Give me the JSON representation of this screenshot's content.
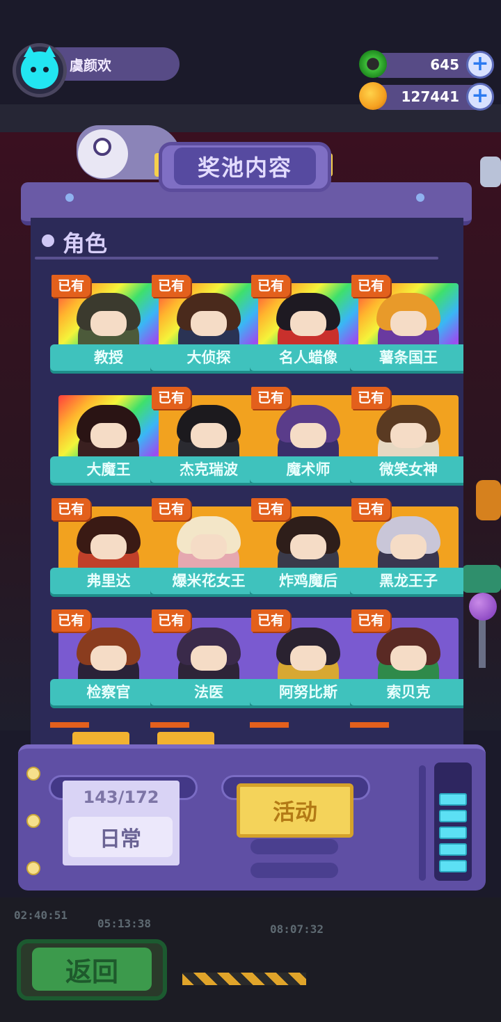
{
  "player": {
    "name": "虞颜欢"
  },
  "currencies": [
    {
      "icon": "green-ring-icon",
      "value": "645",
      "color": "#3fbf3a"
    },
    {
      "icon": "orange-planet-icon",
      "value": "127441",
      "color": "#f5a020"
    }
  ],
  "panel": {
    "title": "奖池内容",
    "section": "角色"
  },
  "owned_label": "已有",
  "characters": [
    {
      "name": "教授",
      "owned": true,
      "rarity": "rainbow",
      "hair": "#3b3a2e",
      "body": "#4c5a3a"
    },
    {
      "name": "大侦探",
      "owned": true,
      "rarity": "rainbow",
      "hair": "#4a2a1c",
      "body": "#2a3354"
    },
    {
      "name": "名人蜡像",
      "owned": true,
      "rarity": "rainbow",
      "hair": "#1e1a22",
      "body": "#c9302c"
    },
    {
      "name": "薯条国王",
      "owned": true,
      "rarity": "rainbow",
      "hair": "#e89a2a",
      "body": "#6a3aa0"
    },
    {
      "name": "大魔王",
      "owned": false,
      "rarity": "rainbow",
      "hair": "#2a1414",
      "body": "#3a2020"
    },
    {
      "name": "杰克瑞波",
      "owned": true,
      "rarity": "gold",
      "hair": "#1c1a1e",
      "body": "#2a2a30"
    },
    {
      "name": "魔术师",
      "owned": true,
      "rarity": "gold",
      "hair": "#5a3c8a",
      "body": "#3a2e6a"
    },
    {
      "name": "微笑女神",
      "owned": true,
      "rarity": "gold",
      "hair": "#5a3a22",
      "body": "#e6d8c2"
    },
    {
      "name": "弗里达",
      "owned": true,
      "rarity": "gold",
      "hair": "#3a1a14",
      "body": "#c0402a"
    },
    {
      "name": "爆米花女王",
      "owned": true,
      "rarity": "gold",
      "hair": "#f3e6c8",
      "body": "#e5a8b0"
    },
    {
      "name": "炸鸡魔后",
      "owned": true,
      "rarity": "gold",
      "hair": "#2e1e1a",
      "body": "#3a3a4a"
    },
    {
      "name": "黑龙王子",
      "owned": true,
      "rarity": "gold",
      "hair": "#c9c6d8",
      "body": "#3a3650"
    },
    {
      "name": "检察官",
      "owned": true,
      "rarity": "purple",
      "hair": "#8a3c1e",
      "body": "#2a2238"
    },
    {
      "name": "法医",
      "owned": true,
      "rarity": "purple",
      "hair": "#3a2a4a",
      "body": "#2e2438"
    },
    {
      "name": "阿努比斯",
      "owned": true,
      "rarity": "purple",
      "hair": "#2a2230",
      "body": "#d8a832"
    },
    {
      "name": "索贝克",
      "owned": true,
      "rarity": "purple",
      "hair": "#5a2a24",
      "body": "#2f8a4a"
    }
  ],
  "pool_tabs": {
    "progress": "143/172",
    "daily_label": "日常",
    "event_label": "活动"
  },
  "timers": [
    "02:40:51",
    "05:13:38",
    "08:07:32"
  ],
  "back_label": "返回"
}
